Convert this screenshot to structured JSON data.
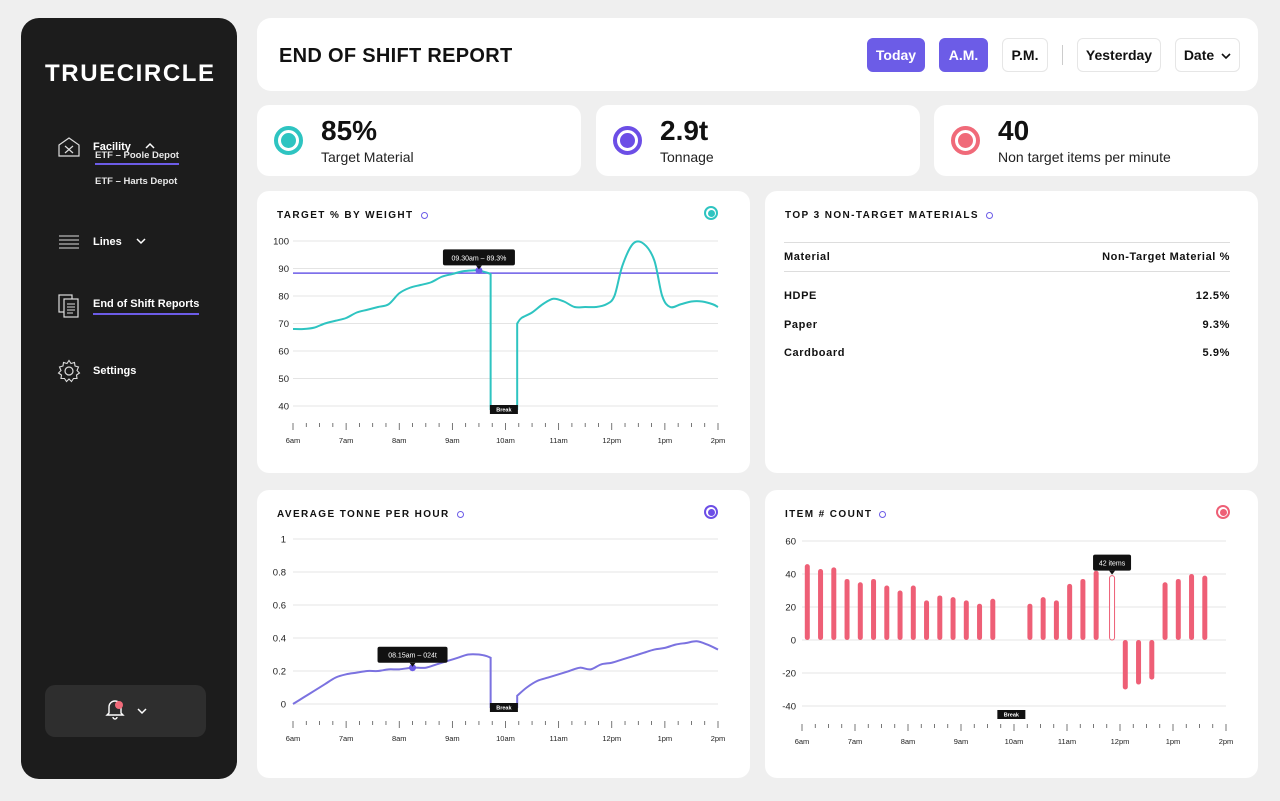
{
  "brand": "TRUECIRCLE",
  "sidebar": {
    "facility_label": "Facility",
    "facility_items": [
      "ETF – Poole Depot",
      "ETF – Harts Depot"
    ],
    "lines_label": "Lines",
    "reports_label": "End of Shift Reports",
    "settings_label": "Settings"
  },
  "header": {
    "title": "END OF SHIFT REPORT",
    "buttons": {
      "today": "Today",
      "am": "A.M.",
      "pm": "P.M.",
      "yesterday": "Yesterday",
      "date": "Date"
    }
  },
  "kpis": [
    {
      "value": "85%",
      "label": "Target Material",
      "color": "#2ec4c1"
    },
    {
      "value": "2.9t",
      "label": "Tonnage",
      "color": "#6c4ee6"
    },
    {
      "value": "40",
      "label": "Non target items per minute",
      "color": "#f06a79"
    }
  ],
  "colors": {
    "accent": "#6c5ce7",
    "teal": "#2ec4c1",
    "purple": "#6c4ee6",
    "pink": "#ee5f76"
  },
  "top3": {
    "title": "TOP 3 NON-TARGET MATERIALS",
    "col_material": "Material",
    "col_pct": "Non-Target Material %",
    "rows": [
      {
        "material": "HDPE",
        "pct": "12.5%"
      },
      {
        "material": "Paper",
        "pct": "9.3%"
      },
      {
        "material": "Cardboard",
        "pct": "5.9%"
      }
    ]
  },
  "chart_data": [
    {
      "type": "line",
      "title": "TARGET % BY WEIGHT",
      "x_ticks": [
        "6am",
        "7am",
        "8am",
        "9am",
        "10am",
        "11am",
        "12pm",
        "1pm",
        "2pm"
      ],
      "y_ticks": [
        100,
        90,
        80,
        70,
        60,
        50,
        40
      ],
      "ylim": [
        40,
        100
      ],
      "target_line": 88.3,
      "tooltip": "09.30am – 89.3%",
      "tooltip_x": 9.5,
      "break_label": "Break",
      "break_range": [
        9.72,
        10.22
      ],
      "series": [
        {
          "x": [
            6,
            6.2,
            6.4,
            6.6,
            6.8,
            7,
            7.2,
            7.4,
            7.6,
            7.8,
            8,
            8.2,
            8.4,
            8.6,
            8.8,
            9,
            9.2,
            9.4,
            9.5,
            9.65,
            9.72
          ],
          "y": [
            68,
            68,
            68.5,
            70,
            71,
            72,
            74,
            75,
            76,
            77,
            81,
            83,
            84,
            85,
            87,
            88,
            89,
            89.3,
            89.3,
            88.5,
            88
          ]
        },
        {
          "x": [
            10.22,
            10.3,
            10.5,
            10.7,
            10.9,
            11.1,
            11.3,
            11.5,
            11.7,
            11.9,
            12.05,
            12.2,
            12.4,
            12.6,
            12.8,
            12.95,
            13.1,
            13.3,
            13.5,
            13.7,
            13.9,
            14
          ],
          "y": [
            70,
            72,
            74,
            77,
            79,
            78,
            76,
            76,
            76,
            77,
            80,
            91,
            99,
            99,
            93,
            80,
            76,
            77,
            78,
            78,
            77,
            76
          ]
        }
      ]
    },
    {
      "type": "line",
      "title": "AVERAGE TONNE PER HOUR",
      "x_ticks": [
        "6am",
        "7am",
        "8am",
        "9am",
        "10am",
        "11am",
        "12pm",
        "1pm",
        "2pm"
      ],
      "y_ticks": [
        1,
        0.8,
        0.6,
        0.4,
        0.2,
        0
      ],
      "ylim": [
        -0.05,
        1
      ],
      "tooltip": "08.15am – 024t",
      "tooltip_x": 8.25,
      "break_label": "Break",
      "break_range": [
        9.72,
        10.22
      ],
      "series": [
        {
          "x": [
            6,
            6.2,
            6.4,
            6.6,
            6.8,
            7,
            7.2,
            7.4,
            7.6,
            7.8,
            8,
            8.25,
            8.5,
            8.7,
            8.9,
            9.1,
            9.3,
            9.5,
            9.65,
            9.72
          ],
          "y": [
            0,
            0.04,
            0.08,
            0.12,
            0.16,
            0.18,
            0.19,
            0.2,
            0.2,
            0.21,
            0.21,
            0.22,
            0.22,
            0.24,
            0.26,
            0.28,
            0.3,
            0.3,
            0.29,
            0.28
          ]
        },
        {
          "x": [
            10.22,
            10.4,
            10.6,
            10.8,
            11,
            11.2,
            11.4,
            11.6,
            11.8,
            12,
            12.2,
            12.4,
            12.6,
            12.8,
            13,
            13.2,
            13.4,
            13.6,
            13.8,
            14
          ],
          "y": [
            0.05,
            0.1,
            0.14,
            0.16,
            0.18,
            0.2,
            0.22,
            0.21,
            0.24,
            0.25,
            0.27,
            0.29,
            0.31,
            0.33,
            0.34,
            0.36,
            0.37,
            0.38,
            0.36,
            0.33
          ]
        }
      ]
    },
    {
      "type": "bar",
      "title": "ITEM # COUNT",
      "x_ticks": [
        "6am",
        "7am",
        "8am",
        "9am",
        "10am",
        "11am",
        "12pm",
        "1pm",
        "2pm"
      ],
      "y_ticks": [
        60,
        40,
        20,
        0,
        -20,
        -40
      ],
      "ylim": [
        -40,
        60
      ],
      "tooltip": "42 items",
      "highlight_index": 21,
      "break_label": "Break",
      "x": [
        6.1,
        6.35,
        6.6,
        6.85,
        7.1,
        7.35,
        7.6,
        7.85,
        8.1,
        8.35,
        8.6,
        8.85,
        9.1,
        9.35,
        9.6,
        10.3,
        10.55,
        10.8,
        11.05,
        11.3,
        11.55,
        11.85,
        12.1,
        12.35,
        12.6,
        12.85,
        13.1,
        13.35,
        13.6,
        13.85
      ],
      "values": [
        46,
        43,
        44,
        37,
        35,
        37,
        33,
        30,
        33,
        24,
        27,
        26,
        24,
        22,
        25,
        22,
        26,
        24,
        34,
        37,
        42,
        39,
        -30,
        -27,
        -24,
        35,
        37,
        40,
        39,
        0
      ]
    }
  ]
}
